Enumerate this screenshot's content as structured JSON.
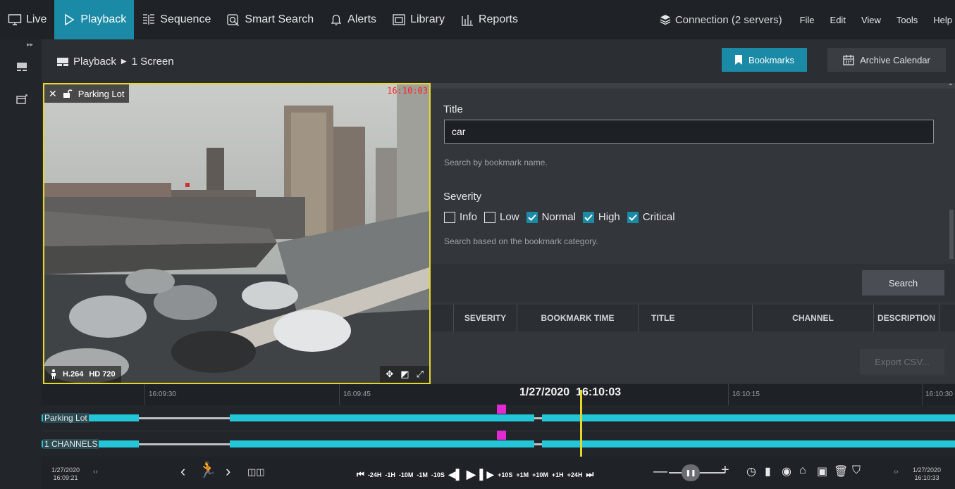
{
  "nav": {
    "live": "Live",
    "playback": "Playback",
    "sequence": "Sequence",
    "smart_search": "Smart Search",
    "alerts": "Alerts",
    "library": "Library",
    "reports": "Reports"
  },
  "connection": "Connection (2 servers)",
  "menu": {
    "file": "File",
    "edit": "Edit",
    "view": "View",
    "tools": "Tools",
    "help": "Help"
  },
  "breadcrumb": {
    "root": "Playback",
    "child": "1 Screen"
  },
  "buttons": {
    "bookmarks": "Bookmarks",
    "archive_calendar": "Archive Calendar",
    "search": "Search",
    "export_csv": "Export CSV..."
  },
  "camera": {
    "name": "Parking Lot",
    "timestamp": "16:10:03",
    "codec": "H.264",
    "resolution": "HD 720"
  },
  "filter": {
    "title_label": "Title",
    "title_value": "car",
    "title_hint": "Search by bookmark name.",
    "severity_label": "Severity",
    "severity_hint": "Search based on the bookmark category.",
    "severities": [
      {
        "label": "Info",
        "checked": false
      },
      {
        "label": "Low",
        "checked": false
      },
      {
        "label": "Normal",
        "checked": true
      },
      {
        "label": "High",
        "checked": true
      },
      {
        "label": "Critical",
        "checked": true
      }
    ]
  },
  "table": {
    "columns": [
      "SEVERITY",
      "BOOKMARK TIME",
      "TITLE",
      "CHANNEL",
      "DESCRIPTION"
    ]
  },
  "timeline": {
    "current": "1/27/2020  16:10:03",
    "ticks": [
      "16:09:30",
      "16:09:45",
      "16:10:15",
      "16:10:30"
    ],
    "tracks": [
      "Parking Lot",
      "1 CHANNELS"
    ]
  },
  "controls": {
    "start_date": "1/27/2020",
    "start_time": "16:09:21",
    "end_date": "1/27/2020",
    "end_time": "16:10:33",
    "back_jumps": [
      "-24H",
      "-1H",
      "-10M",
      "-1M",
      "-10S"
    ],
    "fwd_jumps": [
      "+10S",
      "+1M",
      "+10M",
      "+1H",
      "+24H"
    ]
  },
  "colors": {
    "accent": "#1b8aa6",
    "selection": "#e6d72b",
    "recording": "#22c6d6",
    "bookmark": "#e22ad2",
    "timestamp": "#ff2020"
  }
}
